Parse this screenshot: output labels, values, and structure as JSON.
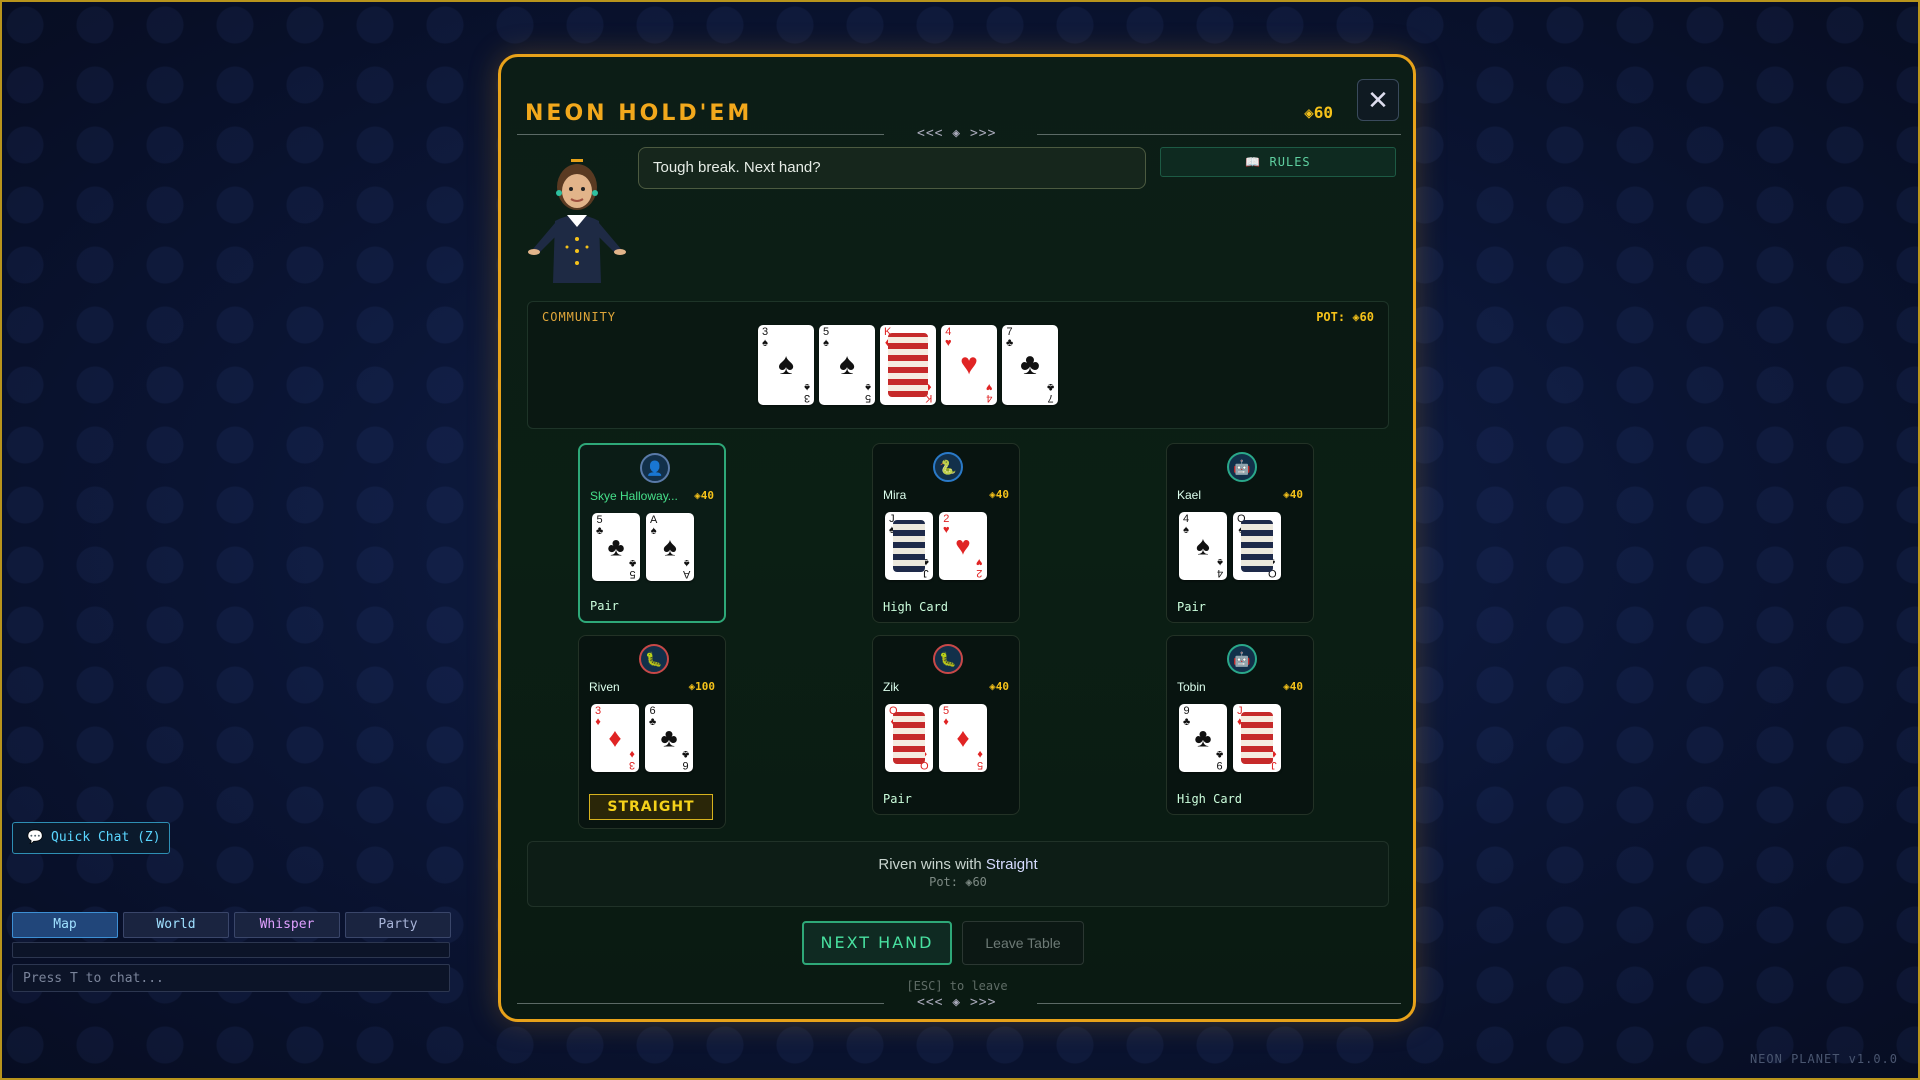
{
  "game": {
    "title": "NEON HOLD'EM",
    "coins": "◈60",
    "close_icon": "close-icon",
    "ornament_top": "<<< ◈ >>>",
    "ornament_bottom": "<<< ◈ >>>"
  },
  "dealer": {
    "speech": "Tough break. Next hand?"
  },
  "rules_button": {
    "icon": "book-icon",
    "label": "RULES"
  },
  "community": {
    "label": "COMMUNITY",
    "pot": "POT: ◈60",
    "cards": [
      {
        "rank": "3",
        "suit": "♠",
        "color": "black"
      },
      {
        "rank": "5",
        "suit": "♠",
        "color": "black"
      },
      {
        "rank": "K",
        "suit": "♦",
        "color": "red",
        "face": true
      },
      {
        "rank": "4",
        "suit": "♥",
        "color": "red"
      },
      {
        "rank": "7",
        "suit": "♣",
        "color": "black"
      }
    ]
  },
  "players": [
    {
      "name": "Skye Halloway...",
      "chips": "◈40",
      "hand": "Pair",
      "you": true,
      "icon": "user-icon",
      "cards": [
        {
          "rank": "5",
          "suit": "♣",
          "color": "black"
        },
        {
          "rank": "A",
          "suit": "♠",
          "color": "black"
        }
      ]
    },
    {
      "name": "Mira",
      "chips": "◈40",
      "hand": "High Card",
      "icon": "snake-icon",
      "cards": [
        {
          "rank": "J",
          "suit": "♠",
          "color": "black",
          "face": true
        },
        {
          "rank": "2",
          "suit": "♥",
          "color": "red"
        }
      ]
    },
    {
      "name": "Kael",
      "chips": "◈40",
      "hand": "Pair",
      "icon": "robot-icon",
      "cards": [
        {
          "rank": "4",
          "suit": "♠",
          "color": "black"
        },
        {
          "rank": "Q",
          "suit": "♠",
          "color": "black",
          "face": true
        }
      ]
    },
    {
      "name": "Riven",
      "chips": "◈100",
      "hand": "STRAIGHT",
      "winner": true,
      "icon": "worm-icon",
      "cards": [
        {
          "rank": "3",
          "suit": "♦",
          "color": "red"
        },
        {
          "rank": "6",
          "suit": "♣",
          "color": "black"
        }
      ]
    },
    {
      "name": "Zik",
      "chips": "◈40",
      "hand": "Pair",
      "icon": "worm-icon",
      "cards": [
        {
          "rank": "Q",
          "suit": "♦",
          "color": "red",
          "face": true
        },
        {
          "rank": "5",
          "suit": "♦",
          "color": "red"
        }
      ]
    },
    {
      "name": "Tobin",
      "chips": "◈40",
      "hand": "High Card",
      "icon": "robot-icon",
      "cards": [
        {
          "rank": "9",
          "suit": "♣",
          "color": "black"
        },
        {
          "rank": "J",
          "suit": "♦",
          "color": "red",
          "face": true
        }
      ]
    }
  ],
  "result": {
    "prefix": "Riven wins with ",
    "hand": "Straight",
    "pot": "Pot: ◈60"
  },
  "actions": {
    "next_hand": "NEXT HAND",
    "leave_table": "Leave Table",
    "esc_hint": "[ESC] to leave"
  },
  "chat": {
    "quick_chat": "Quick Chat (Z)",
    "tabs": [
      "Map",
      "World",
      "Whisper",
      "Party"
    ],
    "active_tab": "Map",
    "placeholder": "Press T to chat..."
  },
  "version": "NEON PLANET v1.0.0",
  "colors": {
    "accent": "#e8a21a",
    "green": "#2ea878",
    "gold": "#f5c21a",
    "cyan": "#5ad6ff"
  }
}
